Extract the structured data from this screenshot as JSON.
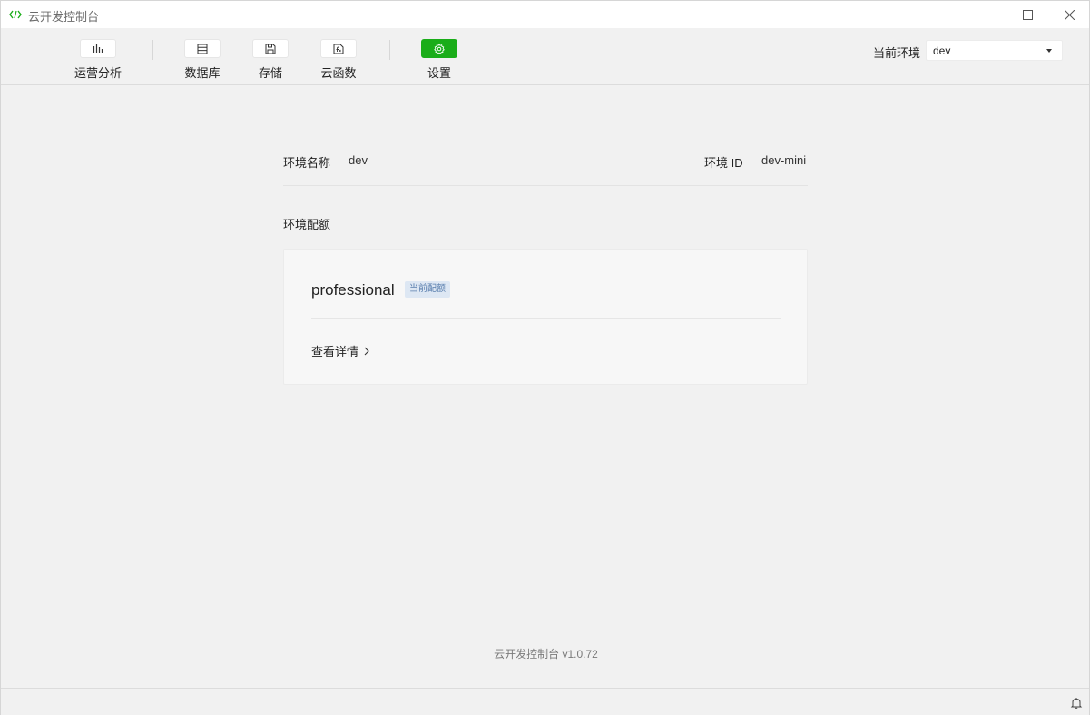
{
  "window": {
    "title": "云开发控制台"
  },
  "toolbar": {
    "items": [
      {
        "label": "运营分析",
        "icon": "bar-chart-icon"
      },
      {
        "label": "数据库",
        "icon": "database-icon"
      },
      {
        "label": "存储",
        "icon": "storage-icon"
      },
      {
        "label": "云函数",
        "icon": "function-icon"
      },
      {
        "label": "设置",
        "icon": "gear-icon",
        "active": true
      }
    ],
    "env_label": "当前环境",
    "env_value": "dev"
  },
  "main": {
    "env_name_label": "环境名称",
    "env_name_value": "dev",
    "env_id_label": "环境 ID",
    "env_id_value": "dev-mini",
    "quota_title": "环境配额",
    "plan_name": "professional",
    "plan_badge": "当前配额",
    "detail_link": "查看详情"
  },
  "footer": {
    "version": "云开发控制台 v1.0.72"
  },
  "colors": {
    "accent": "#1aad19",
    "badge_bg": "#dde7f3",
    "badge_text": "#5a7fae"
  }
}
